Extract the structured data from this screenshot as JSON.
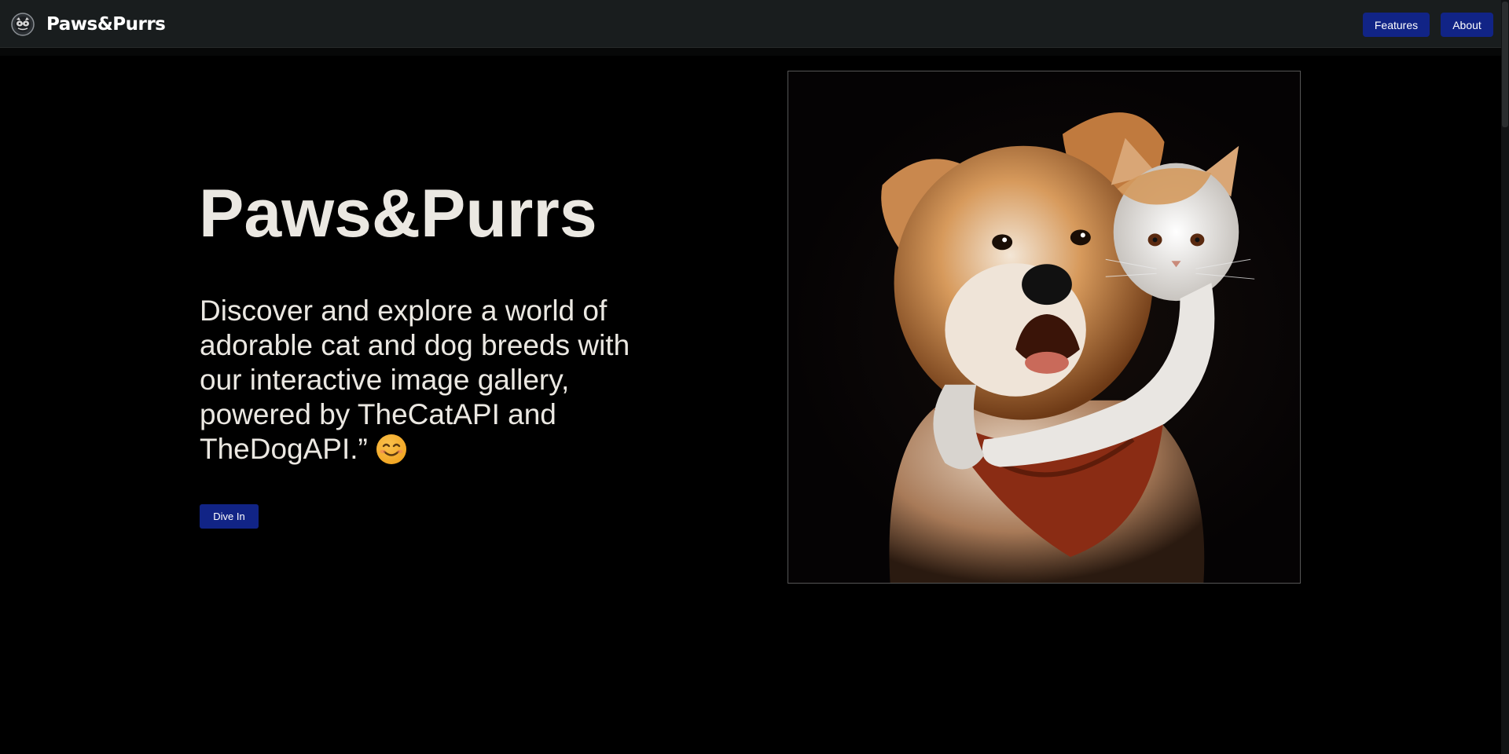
{
  "navbar": {
    "brand": "Paws&Purrs",
    "logo_icon": "paw-logo-icon",
    "links": [
      {
        "label": "Features"
      },
      {
        "label": "About"
      }
    ],
    "button_color": "#112486"
  },
  "hero": {
    "title": "Paws&Purrs",
    "description": "Discover and explore a world of adorable cat and dog breeds with our interactive image gallery, powered by TheCatAPI and TheDogAPI.”",
    "emoji_icon": "smiling-face-icon",
    "cta_label": "Dive In",
    "image_subject": "dog-and-cat-hug-image"
  },
  "colors": {
    "background": "#000000",
    "navbar": "#191d1e",
    "text": "#ebe8e2",
    "accent": "#112486"
  }
}
